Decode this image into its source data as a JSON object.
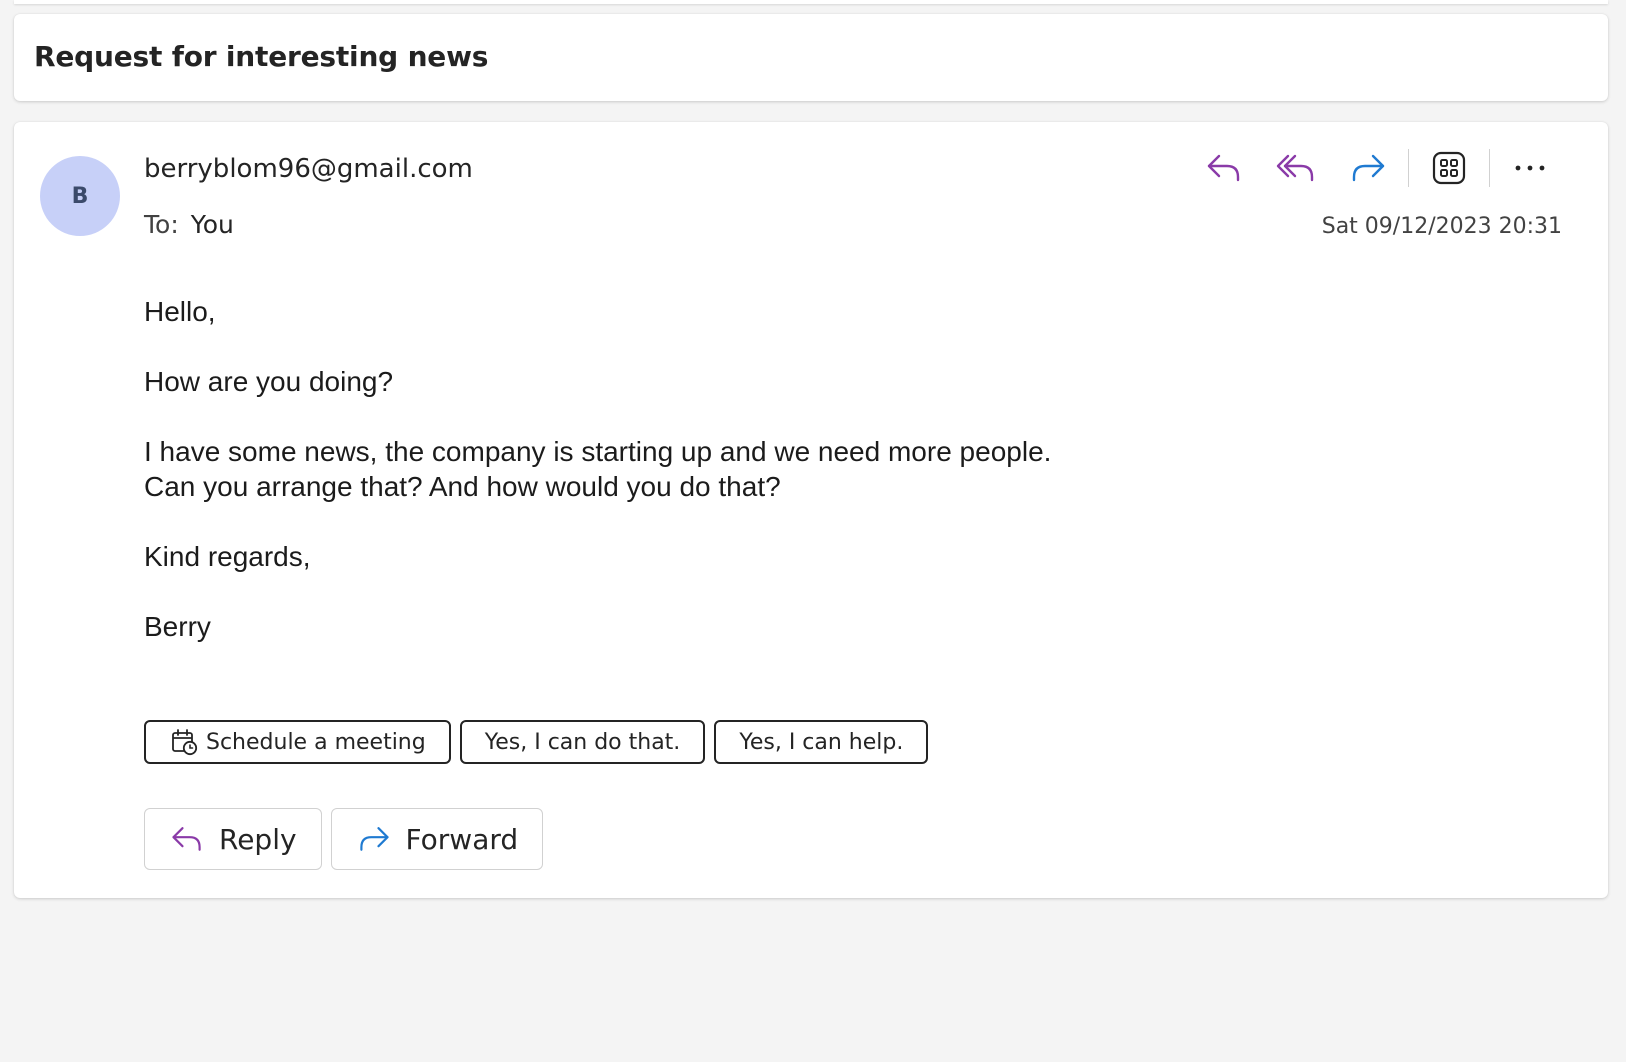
{
  "email": {
    "subject": "Request for interesting news",
    "sender": "berryblom96@gmail.com",
    "avatar_initial": "B",
    "to_label": "To:",
    "to_value": "You",
    "timestamp": "Sat 09/12/2023 20:31",
    "body": [
      "Hello,",
      "How are you doing?",
      "I have some news, the company is starting up and we need more people.",
      "Can you arrange that? And how would you do that?",
      "Kind regards,",
      "Berry"
    ]
  },
  "toolbar": {
    "icons": [
      "reply-icon",
      "reply-all-icon",
      "forward-icon",
      "apps-icon",
      "more-icon"
    ]
  },
  "suggestions": [
    "Schedule a meeting",
    "Yes, I can do that.",
    "Yes, I can help."
  ],
  "actions": {
    "reply_label": "Reply",
    "forward_label": "Forward"
  },
  "colors": {
    "reply_purple": "#8a3aa8",
    "forward_blue": "#1f7ad1",
    "avatar_bg": "#c7d0f8",
    "page_bg": "#f4f4f4"
  }
}
